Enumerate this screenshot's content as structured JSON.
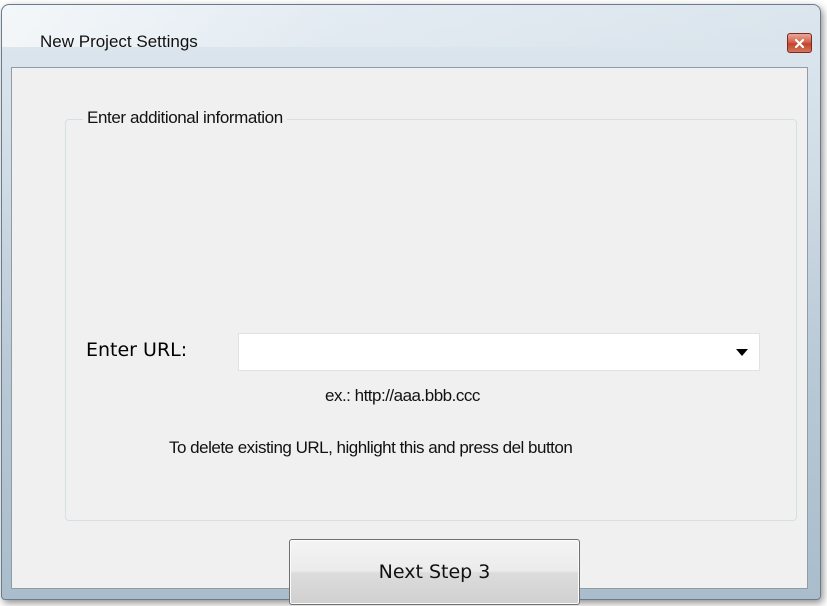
{
  "window": {
    "title": "New Project Settings"
  },
  "group": {
    "title": "Enter additional information"
  },
  "url_field": {
    "label": "Enter URL:",
    "value": "",
    "hint": "ex.: http://aaa.bbb.ccc",
    "instruction": "To delete existing URL, highlight this and press del button"
  },
  "buttons": {
    "next_label": "Next Step 3"
  },
  "icons": {
    "close": "close-icon",
    "dropdown": "chevron-down-icon"
  },
  "colors": {
    "close_button": "#c9452d",
    "client_background": "#f0f0f0",
    "window_frame": "#b9c9d6"
  }
}
